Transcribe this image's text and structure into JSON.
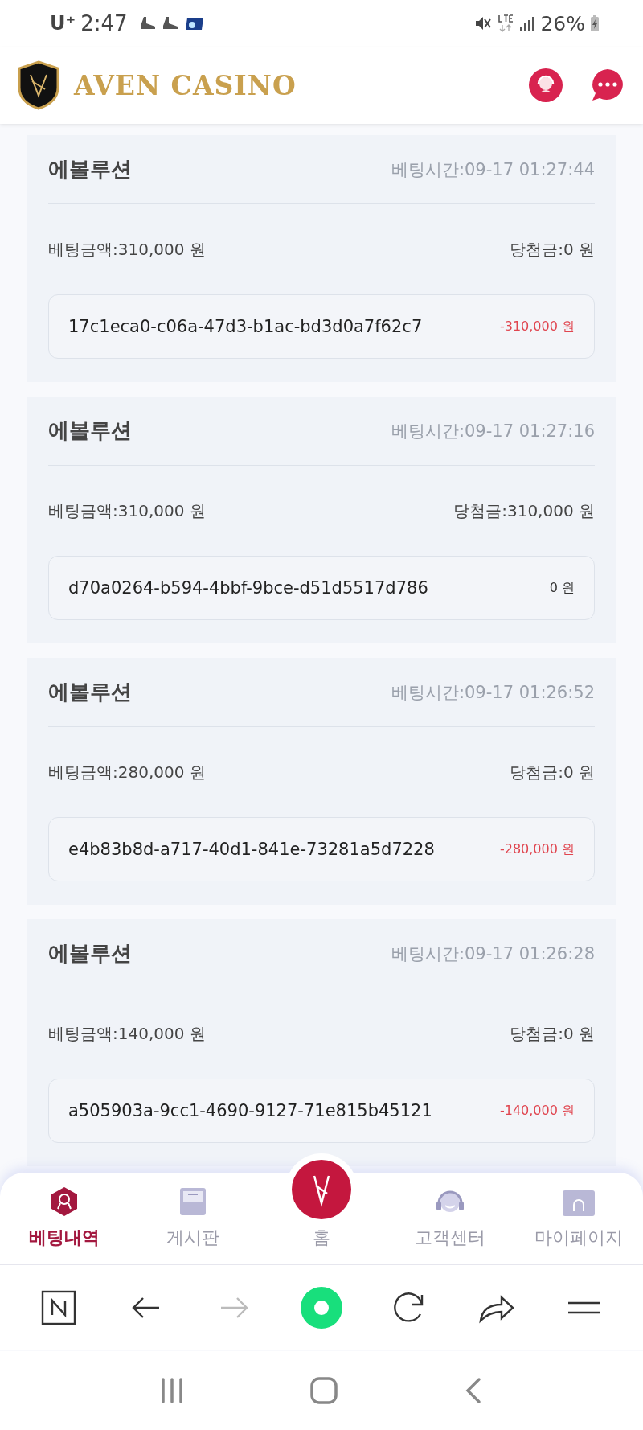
{
  "status_bar": {
    "carrier": "U⁺",
    "time": "2:47",
    "battery": "26%"
  },
  "header": {
    "brand": "AVEN CASINO"
  },
  "bets": [
    {
      "game": "에볼루션",
      "time": "베팅시간:09-17 01:27:44",
      "stake": "베팅금액:310,000 원",
      "win": "당첨금:0 원",
      "id": "17c1eca0-c06a-47d3-b1ac-bd3d0a7f62c7",
      "result": "-310,000 원",
      "color": "#e0454f"
    },
    {
      "game": "에볼루션",
      "time": "베팅시간:09-17 01:27:16",
      "stake": "베팅금액:310,000 원",
      "win": "당첨금:310,000 원",
      "id": "d70a0264-b594-4bbf-9bce-d51d5517d786",
      "result": "0 원",
      "color": "#333333"
    },
    {
      "game": "에볼루션",
      "time": "베팅시간:09-17 01:26:52",
      "stake": "베팅금액:280,000 원",
      "win": "당첨금:0 원",
      "id": "e4b83b8d-a717-40d1-841e-73281a5d7228",
      "result": "-280,000 원",
      "color": "#e0454f"
    },
    {
      "game": "에볼루션",
      "time": "베팅시간:09-17 01:26:28",
      "stake": "베팅금액:140,000 원",
      "win": "당첨금:0 원",
      "id": "a505903a-9cc1-4690-9127-71e815b45121",
      "result": "-140,000 원",
      "color": "#e0454f"
    }
  ],
  "bottom_nav": [
    {
      "label": "베팅내역",
      "kind": "badge",
      "selected": true
    },
    {
      "label": "게시판",
      "kind": "board",
      "selected": false
    },
    {
      "label": "홈",
      "kind": "home",
      "selected": false
    },
    {
      "label": "고객센터",
      "kind": "headset",
      "selected": false
    },
    {
      "label": "마이페이지",
      "kind": "folder",
      "selected": false
    }
  ],
  "browser_bar": [
    {
      "kind": "n",
      "disabled": false
    },
    {
      "kind": "back",
      "disabled": false
    },
    {
      "kind": "forward",
      "disabled": true
    },
    {
      "kind": "home",
      "disabled": false
    },
    {
      "kind": "reload",
      "disabled": false
    },
    {
      "kind": "share",
      "disabled": false
    },
    {
      "kind": "menu",
      "disabled": false
    }
  ]
}
